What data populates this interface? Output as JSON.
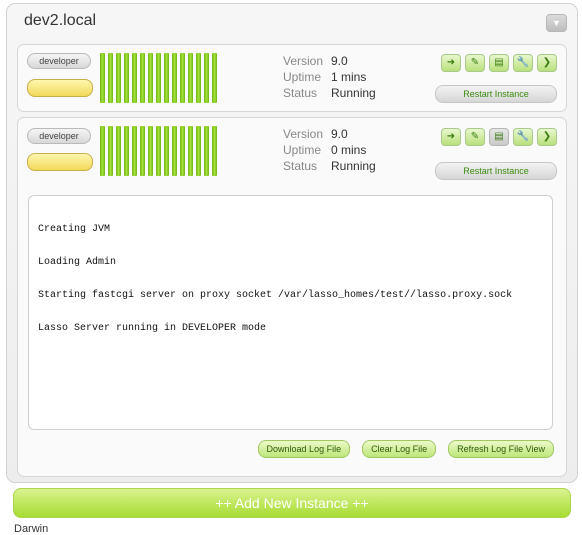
{
  "host": {
    "title": "dev2.local",
    "collapse_icon": "chevron-down-icon"
  },
  "instances": [
    {
      "tag_label": "developer",
      "status_color": "#f2d95a",
      "version_label": "Version",
      "version": "9.0",
      "uptime_label": "Uptime",
      "uptime": "1 mins",
      "status_label": "Status",
      "status": "Running",
      "actions": [
        "arrow-right-icon",
        "pencil-icon",
        "document-icon",
        "wrench-icon",
        "chevron-right-icon"
      ],
      "restart_label": "Restart Instance",
      "bar_count": 15
    },
    {
      "tag_label": "developer",
      "status_color": "#f2d95a",
      "version_label": "Version",
      "version": "9.0",
      "uptime_label": "Uptime",
      "uptime": "0 mins",
      "status_label": "Status",
      "status": "Running",
      "actions": [
        "arrow-right-icon",
        "pencil-icon",
        "document-icon",
        "wrench-icon",
        "chevron-right-icon"
      ],
      "restart_label": "Restart Instance",
      "bar_count": 15,
      "log": {
        "lines": [
          "Creating JVM",
          "Loading Admin",
          "Starting fastcgi server on proxy socket /var/lasso_homes/test//lasso.proxy.sock",
          "Lasso Server running in DEVELOPER mode"
        ],
        "download_label": "Download Log File",
        "clear_label": "Clear Log File",
        "refresh_label": "Refresh Log File View"
      }
    }
  ],
  "add_instance_label": "++ Add New Instance ++",
  "footer_text": "Darwin"
}
